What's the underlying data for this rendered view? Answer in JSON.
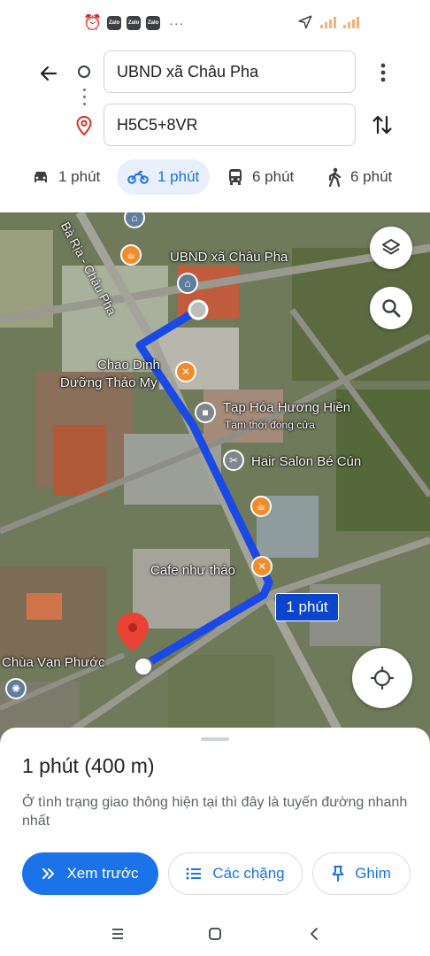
{
  "status_bar": {
    "notification_icons": [
      "alarm-icon",
      "zalo-icon",
      "zalo-icon",
      "zalo-icon"
    ],
    "zalo_label": "Zalo",
    "more": "···"
  },
  "directions": {
    "origin_value": "UBND xã Châu Pha",
    "destination_value": "H5C5+8VR"
  },
  "travel_modes": [
    {
      "icon": "car-icon",
      "label": "1 phút"
    },
    {
      "icon": "motorbike-icon",
      "label": "1 phút",
      "selected": true
    },
    {
      "icon": "transit-icon",
      "label": "6 phút"
    },
    {
      "icon": "walk-icon",
      "label": "6 phút"
    }
  ],
  "map": {
    "road_label": "Bà Rịa - Châu Pha",
    "pois": {
      "ubnd": "UBND xã Châu Pha",
      "chao": [
        "Chao Dinh",
        "Dưỡng Thảo My"
      ],
      "tap_hoa": "Tạp Hóa Hương Hiền",
      "tap_hoa_status": "Tạm thời đóng cửa",
      "hair_salon": "Hair Salon Bé Cún",
      "cafe": "Cafe như thảo",
      "chua": "Chùa Vạn Phước"
    },
    "route_time_label": "1 phút",
    "colors": {
      "route": "#1a49e6",
      "callout": "#0b45ce",
      "food_poi": "#f28b2b",
      "civic_poi": "#5f7e9c",
      "dest_pin": "#ea4335"
    }
  },
  "sheet": {
    "summary": "1 phút (400 m)",
    "description": "Ở tình trạng giao thông hiện tại thì đây là tuyến đường nhanh nhất",
    "preview_label": "Xem trước",
    "steps_label": "Các chặng",
    "pin_label": "Ghim"
  }
}
